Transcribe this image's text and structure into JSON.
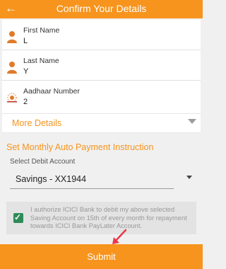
{
  "header": {
    "title": "Confirm Your Details",
    "back_icon": "arrow-left-icon"
  },
  "details": [
    {
      "label": "First Name",
      "value": "L",
      "icon": "person-icon"
    },
    {
      "label": "Last Name",
      "value": "Y",
      "icon": "person-icon"
    },
    {
      "label": "Aadhaar Number",
      "value": "2",
      "icon": "aadhaar-icon"
    }
  ],
  "more_details": {
    "label": "More Details",
    "icon": "triangle-down-icon"
  },
  "auto_payment": {
    "title": "Set Monthly Auto Payment Instruction",
    "debit_label": "Select Debit Account",
    "selected_account": "Savings - XX1944"
  },
  "consent": {
    "checked": true,
    "text": "I authorize ICICI Bank to debit my above selected Saving Account on 15th of every month for repayment towards ICICI Bank PayLater Account."
  },
  "submit": {
    "label": "Submit"
  },
  "colors": {
    "accent": "#f7941d",
    "checkbox": "#2e8b57",
    "annotation": "#e8394b"
  }
}
